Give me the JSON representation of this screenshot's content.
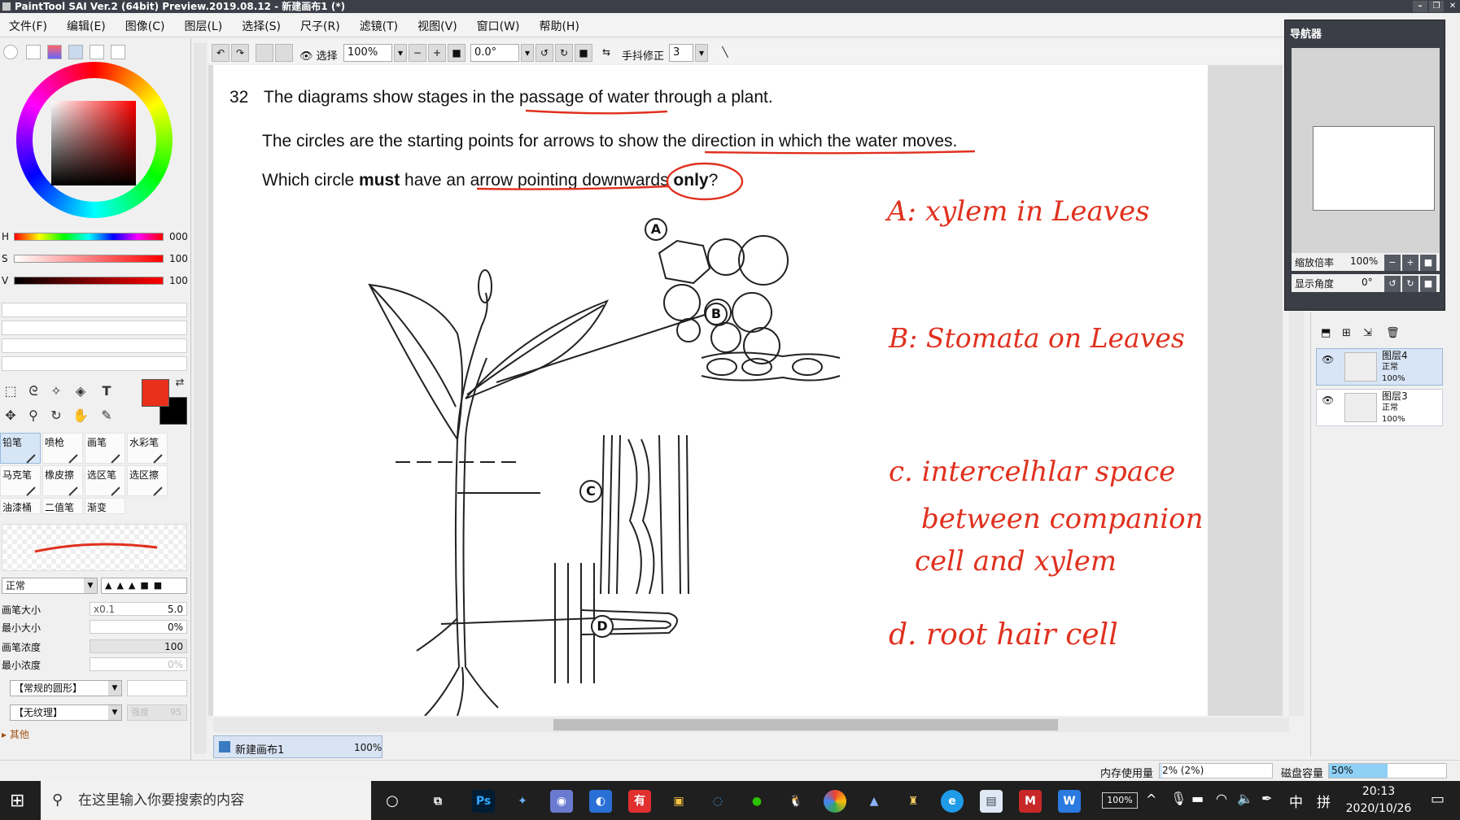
{
  "app": {
    "title": "PaintTool SAI Ver.2 (64bit) Preview.2019.08.12 - 新建画布1 (*)"
  },
  "menu": [
    "文件(F)",
    "编辑(E)",
    "图像(C)",
    "图层(L)",
    "选择(S)",
    "尺子(R)",
    "滤镜(T)",
    "视图(V)",
    "窗口(W)",
    "帮助(H)"
  ],
  "color": {
    "h_label": "H",
    "h_value": "000",
    "s_label": "S",
    "s_value": "100",
    "v_label": "V",
    "v_value": "100",
    "foreground": "#e8301a",
    "background": "#000000"
  },
  "brushes": [
    "铅笔",
    "喷枪",
    "画笔",
    "水彩笔",
    "马克笔",
    "橡皮擦",
    "选区笔",
    "选区擦",
    "油漆桶",
    "二值笔",
    "渐变"
  ],
  "brush_params": {
    "blend_mode": "正常",
    "size_label": "画笔大小",
    "size_mult": "x0.1",
    "size_value": "5.0",
    "min_size_label": "最小大小",
    "min_size_value": "0%",
    "density_label": "画笔浓度",
    "density_value": "100",
    "min_density_label": "最小浓度",
    "min_density_value": "0%",
    "shape": "【常规的圆形】",
    "texture": "【无纹理】",
    "texture_strength": "强度",
    "texture_strength_value": "95",
    "other": "其他"
  },
  "toolbar": {
    "select_label": "选择",
    "zoom": "100%",
    "angle": "0.0°",
    "stabilizer_label": "手抖修正",
    "stabilizer_value": "3"
  },
  "question": {
    "number": "32",
    "line1": "The diagrams show stages in the passage of water through a plant.",
    "line2": "The circles are the starting points for arrows to show the direction in which the water moves.",
    "line3_pre": "Which circle ",
    "line3_bold": "must",
    "line3_mid": " have an arrow pointing downwards ",
    "line3_only": "only",
    "line3_end": "?",
    "labels": [
      "A",
      "B",
      "C",
      "D"
    ]
  },
  "annotations": {
    "a": "A: xylem in Leaves",
    "b": "B: Stomata on Leaves",
    "c1": "c. intercelhlar space",
    "c2": "between companion",
    "c3": "cell and xylem",
    "d": "d. root hair cell"
  },
  "navigator": {
    "title": "导航器",
    "zoom_label": "缩放倍率",
    "zoom_value": "100%",
    "angle_label": "显示角度",
    "angle_value": "0°"
  },
  "layers": [
    {
      "name": "图层4",
      "mode": "正常",
      "opacity": "100%"
    },
    {
      "name": "图层3",
      "mode": "正常",
      "opacity": "100%"
    }
  ],
  "document_tab": {
    "name": "新建画布1",
    "zoom": "100%"
  },
  "status": {
    "memory_label": "内存使用量",
    "memory_value": "2% (2%)",
    "memory_fill": 0.02,
    "disk_label": "磁盘容量",
    "disk_value": "50%",
    "disk_fill": 0.5
  },
  "taskbar": {
    "search_placeholder": "在这里输入你要搜索的内容",
    "time": "20:13",
    "date": "2020/10/26",
    "ime": "中",
    "ime2": "拼",
    "battery": "100%"
  }
}
